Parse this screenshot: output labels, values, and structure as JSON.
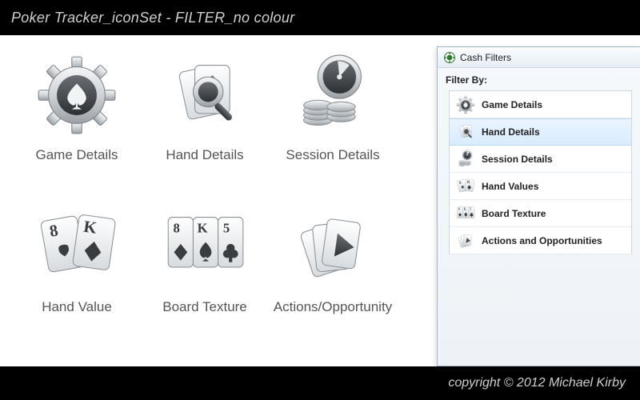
{
  "header": {
    "title": "Poker Tracker_iconSet - FILTER_no colour"
  },
  "footer": {
    "copyright": "copyright © 2012 Michael Kirby"
  },
  "grid": {
    "items": [
      {
        "id": "game-details",
        "label": "Game Details"
      },
      {
        "id": "hand-details",
        "label": "Hand Details"
      },
      {
        "id": "session-details",
        "label": "Session Details"
      },
      {
        "id": "hand-value",
        "label": "Hand Value"
      },
      {
        "id": "board-texture",
        "label": "Board Texture"
      },
      {
        "id": "actions-opp",
        "label": "Actions/Opportunity"
      }
    ]
  },
  "panel": {
    "window_title": "Cash Filters",
    "heading": "Filter By:",
    "items": [
      {
        "id": "game-details",
        "label": "Game Details",
        "selected": false
      },
      {
        "id": "hand-details",
        "label": "Hand Details",
        "selected": true
      },
      {
        "id": "session-details",
        "label": "Session Details",
        "selected": false
      },
      {
        "id": "hand-values",
        "label": "Hand Values",
        "selected": false
      },
      {
        "id": "board-texture",
        "label": "Board Texture",
        "selected": false
      },
      {
        "id": "actions-opp",
        "label": "Actions and Opportunities",
        "selected": false
      }
    ]
  }
}
